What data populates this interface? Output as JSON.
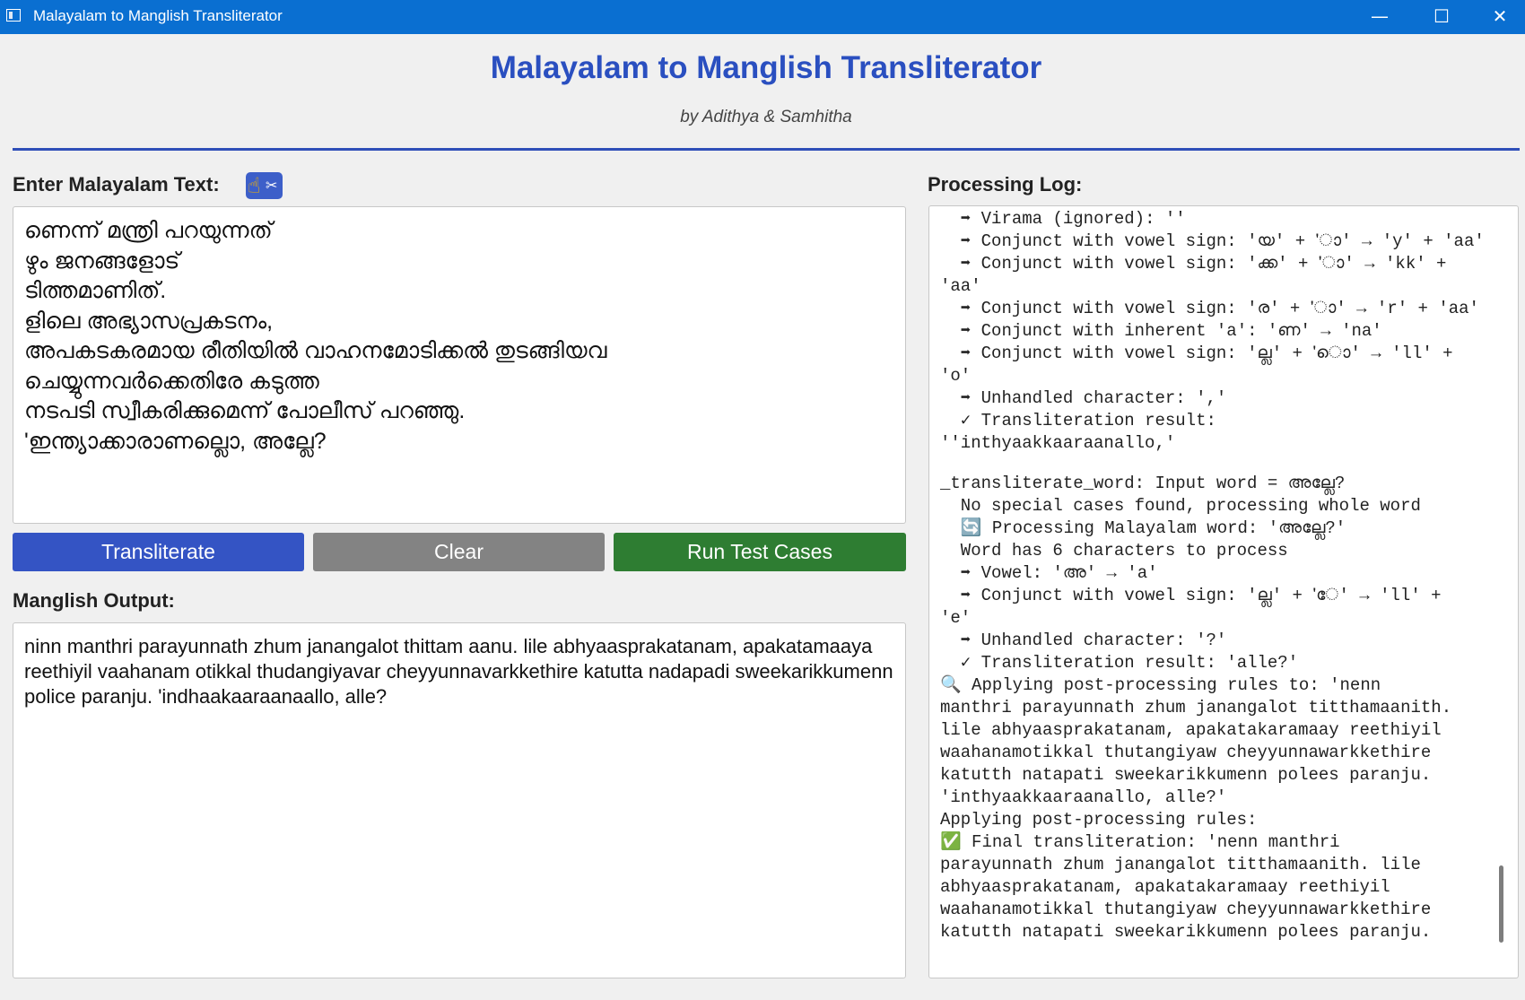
{
  "window": {
    "title": "Malayalam to Manglish Transliterator",
    "minimize": "—",
    "maximize": "☐",
    "close": "✕"
  },
  "header": {
    "title": "Malayalam to Manglish Transliterator",
    "subtitle": "by Adithya & Samhitha"
  },
  "input": {
    "label": "Enter Malayalam Text:",
    "icons": [
      "pointing-hand-icon",
      "scissors-icon"
    ],
    "lines": [
      "ണെന്ന് മന്ത്രി പറയുന്നത്",
      "ഴും ജനങ്ങളോട്",
      "ടിത്തമാണിത്.",
      "ളിലെ അഭ്യാസപ്രകടനം,",
      "അപകടകരമായ രീതിയിൽ വാഹനമോടിക്കൽ തുടങ്ങിയവ",
      "ചെയ്യുന്നവർക്കെതിരേ കടുത്ത",
      "നടപടി സ്വീകരിക്കുമെന്ന് പോലീസ് പറഞ്ഞു.",
      "'ഇന്ത്യാക്കാരാണല്ലൊ, അല്ലേ?"
    ]
  },
  "buttons": {
    "transliterate": "Transliterate",
    "clear": "Clear",
    "run_tests": "Run Test Cases"
  },
  "output": {
    "label": "Manglish Output:",
    "text": "ninn manthri parayunnath zhum janangalot thittam aanu. lile abhyaasprakatanam, apakatamaaya reethiyil vaahanam otikkal thudangiyavar cheyyunnavarkkethire katutta nadapadi sweekarikkumenn police paranju. 'indhaakaaraanaallo, alle?"
  },
  "log": {
    "label": "Processing Log:",
    "lines": [
      "  ➡ Virama (ignored): ''",
      "  ➡ Conjunct with vowel sign: 'യ' + 'ാ' → 'y' + 'aa'",
      "  ➡ Conjunct with vowel sign: 'ക്ക' + 'ാ' → 'kk' +",
      "'aa'",
      "  ➡ Conjunct with vowel sign: 'ര' + 'ാ' → 'r' + 'aa'",
      "  ➡ Conjunct with inherent 'a': 'ണ' → 'na'",
      "  ➡ Conjunct with vowel sign: 'ല്ല' + 'ൊ' → 'll' +",
      "'o'",
      "  ➡ Unhandled character: ','",
      "  ✓ Transliteration result:",
      "''inthyaakkaaraanallo,'",
      "",
      "_transliterate_word: Input word = അല്ലേ?",
      "  No special cases found, processing whole word",
      "  🔄 Processing Malayalam word: 'അല്ലേ?'",
      "  Word has 6 characters to process",
      "  ➡ Vowel: 'അ' → 'a'",
      "  ➡ Conjunct with vowel sign: 'ല്ല' + 'േ' → 'll' +",
      "'e'",
      "  ➡ Unhandled character: '?'",
      "  ✓ Transliteration result: 'alle?'",
      "🔍 Applying post-processing rules to: 'nenn",
      "manthri parayunnath zhum janangalot titthamaanith.",
      "lile abhyaasprakatanam, apakatakaramaay reethiyil",
      "waahanamotikkal thutangiyaw cheyyunnawarkkethire",
      "katutth natapati sweekarikkumenn polees paranju.",
      "'inthyaakkaaraanallo, alle?'",
      "Applying post-processing rules:",
      "✅ Final transliteration: 'nenn manthri",
      "parayunnath zhum janangalot titthamaanith. lile",
      "abhyaasprakatanam, apakatakaramaay reethiyil",
      "waahanamotikkal thutangiyaw cheyyunnawarkkethire",
      "katutth natapati sweekarikkumenn polees paranju."
    ]
  }
}
